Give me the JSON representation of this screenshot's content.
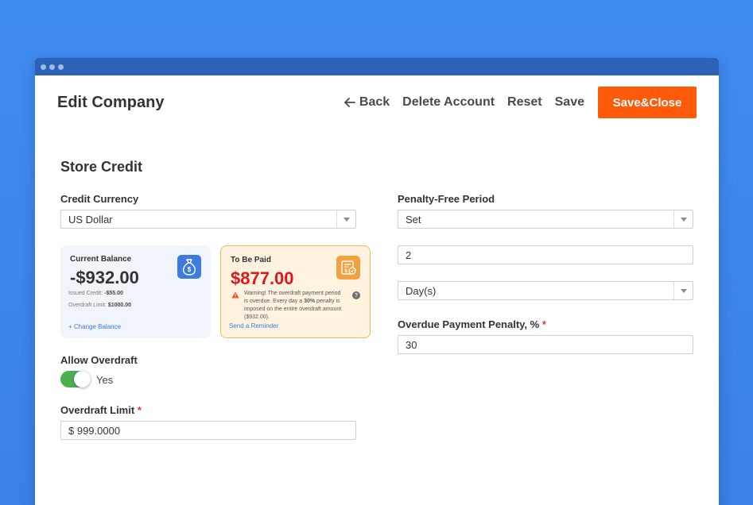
{
  "window": {
    "dots": 3
  },
  "header": {
    "title": "Edit Company",
    "back_label": "Back",
    "delete_label": "Delete Account",
    "reset_label": "Reset",
    "save_label": "Save",
    "save_close_label": "Save&Close"
  },
  "section": {
    "title": "Store Credit"
  },
  "left": {
    "currency_label": "Credit Currency",
    "currency_value": "US Dollar",
    "balance_card": {
      "label": "Current Balance",
      "amount": "-$932.00",
      "issued_label": "Issued Credit:",
      "issued_value": "-$55.00",
      "limit_label": "Overdraft Limit:",
      "limit_value": "$1000.00",
      "link": "+ Change Balance"
    },
    "paid_card": {
      "label": "To Be Paid",
      "amount": "$877.00",
      "warning_pre": "Warning! The overdraft payment period is overdue. Every day a ",
      "warning_bold": "30%",
      "warning_post": " penalty is imposed on the entire overdraft amount ($932.00).",
      "help": "?",
      "link": "Send a Reminder"
    },
    "allow_overdraft_label": "Allow Overdraft",
    "allow_overdraft_value": "Yes",
    "overdraft_limit_label": "Overdraft Limit",
    "overdraft_limit_value": "$ 999.0000"
  },
  "right": {
    "penalty_free_label": "Penalty-Free Period",
    "penalty_free_select": "Set",
    "period_value": "2",
    "period_unit": "Day(s)",
    "penalty_label": "Overdue Payment Penalty, %",
    "penalty_value": "30"
  },
  "colors": {
    "primary": "#ff5a0a",
    "amount_negative": "#333333",
    "amount_due": "#e0161d",
    "link": "#3b7be0",
    "toggle_on": "#4caf50",
    "balance_icon_bg": "#3d7be0",
    "paid_icon_bg": "#f2a040"
  },
  "icons": {
    "back": "arrow-left-icon",
    "balance": "money-bag-icon",
    "paid": "invoice-check-icon",
    "warning": "warning-triangle-icon",
    "help": "help-circle-icon",
    "select": "chevron-down-icon"
  }
}
